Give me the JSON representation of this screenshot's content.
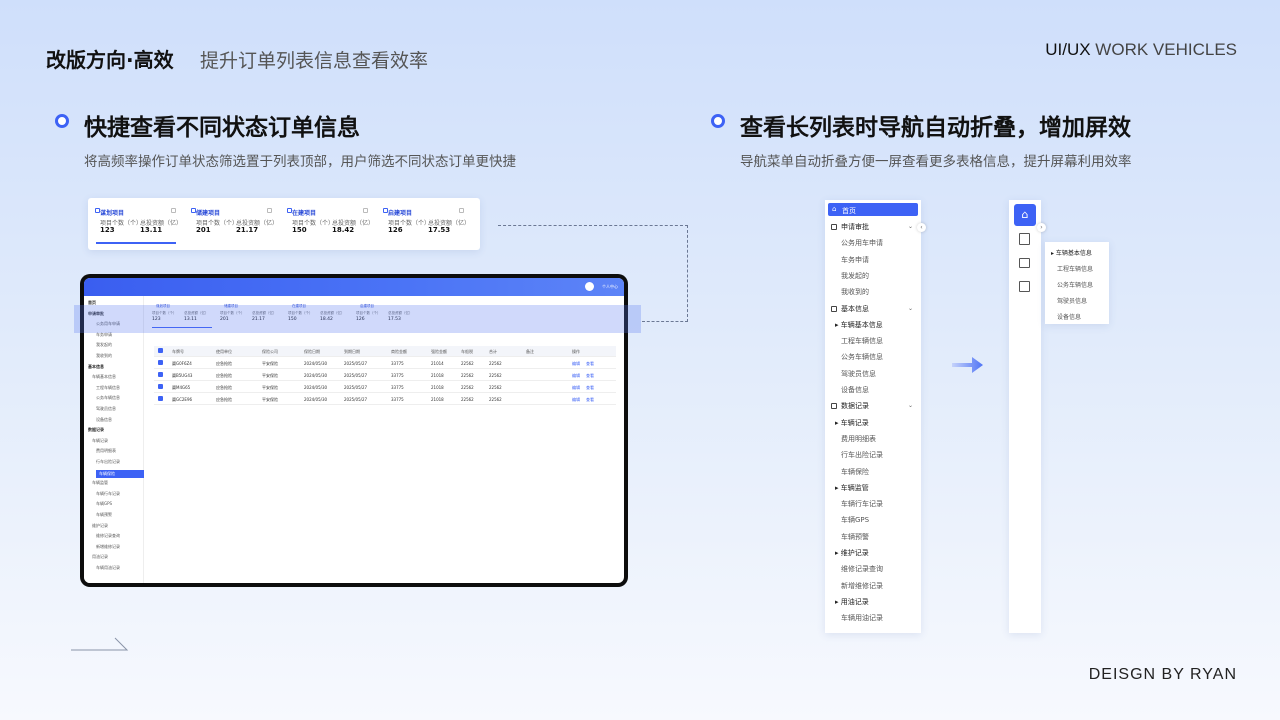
{
  "header": {
    "title": "改版方向·高效",
    "subtitle": "提升订单列表信息查看效率",
    "brand_main": "UI/UX",
    "brand_sub": " WORK VEHICLES"
  },
  "left": {
    "title": "快捷查看不同状态订单信息",
    "desc": "将高频率操作订单状态筛选置于列表顶部，用户筛选不同状态订单更快捷"
  },
  "right": {
    "title": "查看长列表时导航自动折叠，增加屏效",
    "desc": "导航菜单自动折叠方便一屏查看更多表格信息，提升屏幕利用效率"
  },
  "status_cards": [
    {
      "title": "谋划项目",
      "label1": "项目个数（个）",
      "label2": "总投资额（亿）",
      "count": "123",
      "amount": "13.11"
    },
    {
      "title": "储建项目",
      "label1": "项目个数（个）",
      "label2": "总投资额（亿）",
      "count": "201",
      "amount": "21.17"
    },
    {
      "title": "在建项目",
      "label1": "项目个数（个）",
      "label2": "总投资额（亿）",
      "count": "150",
      "amount": "18.42"
    },
    {
      "title": "启建项目",
      "label1": "项目个数（个）",
      "label2": "总投资额（亿）",
      "count": "126",
      "amount": "17.53"
    }
  ],
  "tablet": {
    "user": "个人中心",
    "sidebar": [
      "首页",
      "申请审批",
      "公务用车申请",
      "车务申请",
      "我发起的",
      "我收到的",
      "基本信息",
      "车辆基本信息",
      "工程车辆信息",
      "公务车辆信息",
      "驾驶员信息",
      "设备信息",
      "数据记录",
      "车辆记录",
      "费用明细表",
      "行车出险记录",
      "车辆保险",
      "车辆监管",
      "车辆行车记录",
      "车辆GPS",
      "车辆预警",
      "维护记录",
      "维修记录查询",
      "新增维修记录",
      "用油记录",
      "车辆用油记录"
    ],
    "table_headers": [
      "车牌号",
      "使用单位",
      "保险公司",
      "保险日期",
      "到期日期",
      "商险金额",
      "强险金额",
      "车船税",
      "合计",
      "备注",
      "操作"
    ],
    "rows": [
      [
        "冀G0F6Z4",
        "应急抢险",
        "平安保险",
        "2024/05/30",
        "2025/05/27",
        "33775",
        "21014",
        "22562",
        "22562",
        "",
        "编辑",
        "查看"
      ],
      [
        "冀B5UG43",
        "应急抢险",
        "平安保险",
        "2024/05/30",
        "2025/05/27",
        "33775",
        "21018",
        "22562",
        "22562",
        "",
        "编辑",
        "查看"
      ],
      [
        "冀M4G65",
        "应急抢险",
        "平安保险",
        "2024/05/30",
        "2025/05/27",
        "33775",
        "21018",
        "22562",
        "22562",
        "",
        "编辑",
        "查看"
      ],
      [
        "冀GC2E96",
        "应急抢险",
        "平安保险",
        "2024/05/30",
        "2025/05/27",
        "33775",
        "21018",
        "22562",
        "22562",
        "",
        "编辑",
        "查看"
      ]
    ]
  },
  "expanded_menu": {
    "home": "首页",
    "groups": [
      {
        "label": "申请审批",
        "items": [
          "公务用车申请",
          "车务申请",
          "我发起的",
          "我收到的"
        ]
      },
      {
        "label": "基本信息",
        "sub": "车辆基本信息",
        "items": [
          "工程车辆信息",
          "公务车辆信息",
          "驾驶员信息",
          "设备信息"
        ]
      },
      {
        "label": "数据记录",
        "sub": "车辆记录",
        "items": [
          "费用明细表",
          "行车出险记录",
          "车辆保险"
        ]
      },
      {
        "sub": "车辆监管",
        "items": [
          "车辆行车记录",
          "车辆GPS",
          "车辆预警"
        ]
      },
      {
        "sub": "维护记录",
        "items": [
          "维修记录查询",
          "新增维修记录"
        ]
      },
      {
        "sub": "用油记录",
        "items": [
          "车辆用油记录"
        ]
      }
    ]
  },
  "collapsed_menu": {
    "flyout_title": "车辆基本信息",
    "flyout_items": [
      "工程车辆信息",
      "公务车辆信息",
      "驾驶员信息",
      "设备信息"
    ]
  },
  "footer": "DEISGN BY RYAN"
}
